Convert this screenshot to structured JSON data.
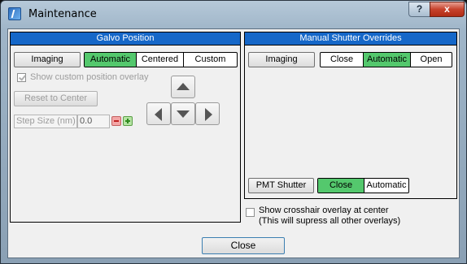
{
  "window": {
    "title": "Maintenance",
    "help_label": "?",
    "close_label": "x"
  },
  "galvo": {
    "title": "Galvo Position",
    "imaging_label": "Imaging",
    "modes": [
      "Automatic",
      "Centered",
      "Custom"
    ],
    "selected_mode": "Automatic",
    "show_overlay_label": "Show custom position overlay",
    "show_overlay_checked": true,
    "reset_label": "Reset to Center",
    "step_size_label": "Step Size (nm)",
    "step_size_value": "0.0"
  },
  "shutter": {
    "title": "Manual Shutter Overrides",
    "imaging_label": "Imaging",
    "modes": [
      "Close",
      "Automatic",
      "Open"
    ],
    "selected_mode": "Automatic",
    "pmt_label": "PMT Shutter",
    "pmt_modes": [
      "Close",
      "Automatic"
    ],
    "pmt_selected": "Close"
  },
  "crosshair": {
    "line1": "Show crosshair overlay at center",
    "line2": "(This will supress all other overlays)",
    "checked": false
  },
  "footer": {
    "close_label": "Close"
  },
  "colors": {
    "header_blue": "#1567c8",
    "selected_green": "#54c86d"
  }
}
